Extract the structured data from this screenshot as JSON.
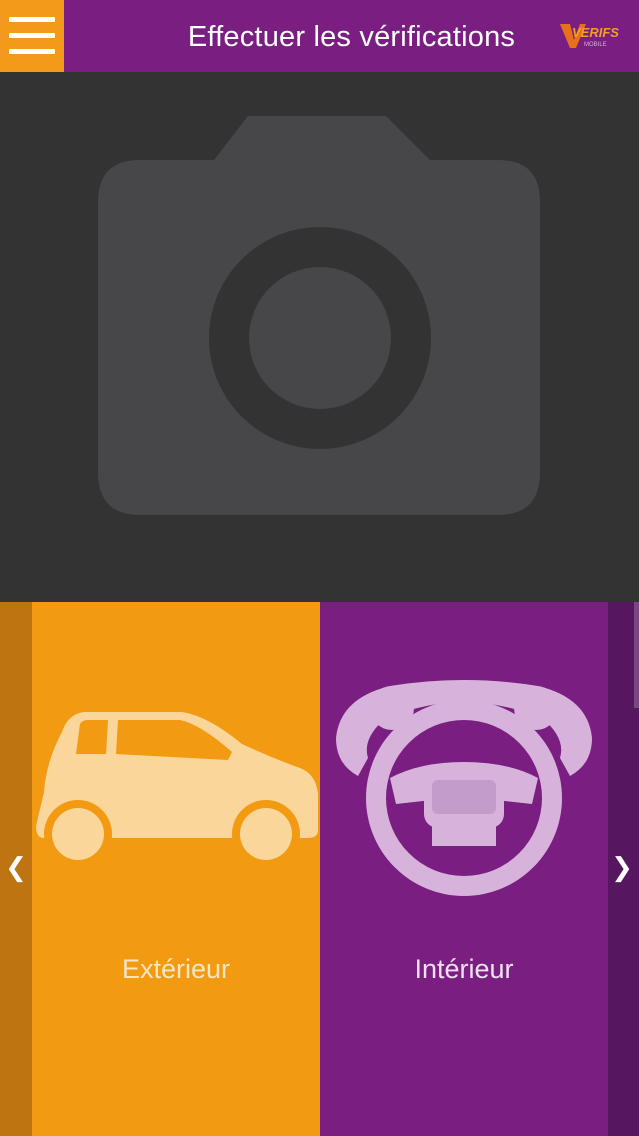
{
  "header": {
    "title": "Effectuer les vérifications",
    "logo_text": "VERIFS",
    "logo_subtext": "MOBILE"
  },
  "photo": {
    "icon": "camera-icon"
  },
  "carousel": {
    "cards": [
      {
        "label": "Extérieur",
        "icon": "car-icon",
        "color": "#f29a12"
      },
      {
        "label": "Intérieur",
        "icon": "steering-wheel-icon",
        "color": "#7a1e82"
      }
    ],
    "prev_icon": "chevron-left-icon",
    "next_icon": "chevron-right-icon"
  },
  "colors": {
    "header": "#7a1e82",
    "menu": "#f39a1a",
    "photo_bg": "#333334"
  }
}
